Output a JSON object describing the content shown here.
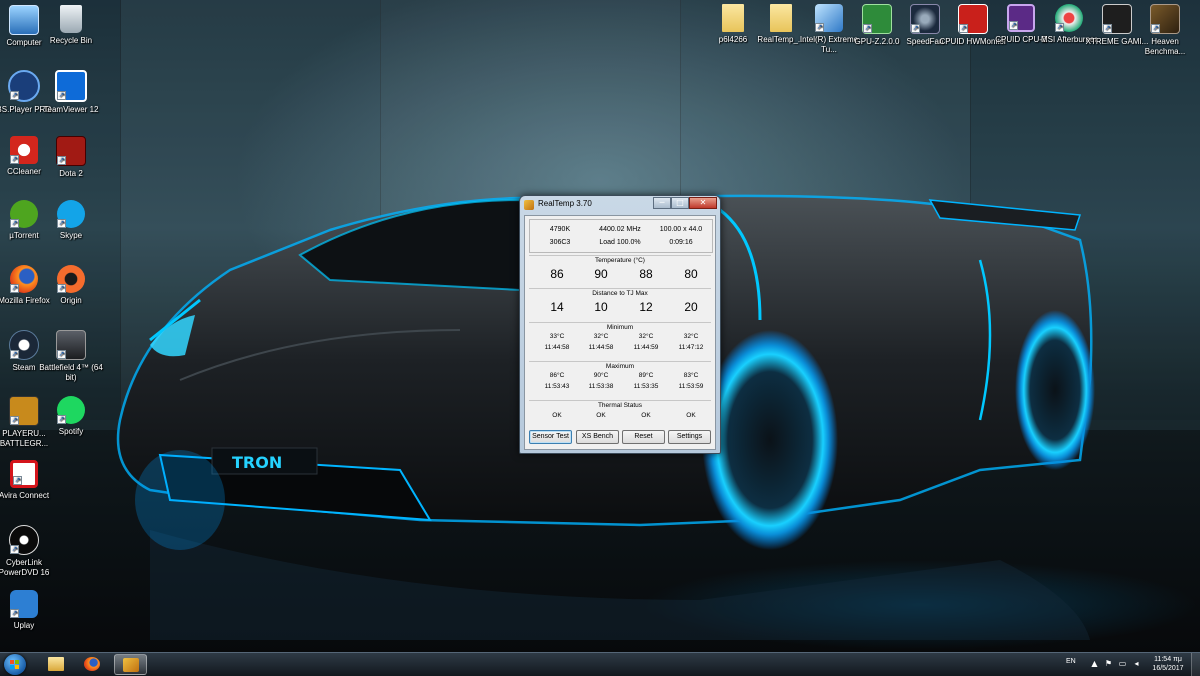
{
  "desktop": {
    "icons_left": [
      {
        "label": "Computer",
        "icon": "computer-icon"
      },
      {
        "label": "Recycle Bin",
        "icon": "recycle-bin-icon"
      },
      {
        "label": "BS.Player PRO",
        "icon": "bsplayer-icon"
      },
      {
        "label": "TeamViewer 12",
        "icon": "teamviewer-icon"
      },
      {
        "label": "CCleaner",
        "icon": "ccleaner-icon"
      },
      {
        "label": "Dota 2",
        "icon": "dota2-icon"
      },
      {
        "label": "µTorrent",
        "icon": "utorrent-icon"
      },
      {
        "label": "Skype",
        "icon": "skype-icon"
      },
      {
        "label": "Mozilla Firefox",
        "icon": "firefox-icon"
      },
      {
        "label": "Origin",
        "icon": "origin-icon"
      },
      {
        "label": "Steam",
        "icon": "steam-icon"
      },
      {
        "label": "Battlefield 4™ (64 bit)",
        "icon": "battlefield4-icon"
      },
      {
        "label": "PLAYERU... BATTLEGR...",
        "icon": "pubg-icon"
      },
      {
        "label": "Spotify",
        "icon": "spotify-icon"
      },
      {
        "label": "Avira Connect",
        "icon": "avira-icon"
      },
      {
        "label": "CyberLink PowerDVD 16",
        "icon": "powerdvd-icon"
      },
      {
        "label": "Uplay",
        "icon": "uplay-icon"
      }
    ],
    "icons_top": [
      {
        "label": "p6l4266",
        "icon": "folder-icon"
      },
      {
        "label": "RealTemp_...",
        "icon": "folder-icon"
      },
      {
        "label": "Intel(R) Extreme Tu...",
        "icon": "intel-xtu-icon"
      },
      {
        "label": "GPU-Z.2.0.0",
        "icon": "gpuz-icon"
      },
      {
        "label": "SpeedFan",
        "icon": "speedfan-icon"
      },
      {
        "label": "CPUID HWMonitor",
        "icon": "hwmonitor-icon"
      },
      {
        "label": "CPUID CPU-Z",
        "icon": "cpuz-icon"
      },
      {
        "label": "MSI Afterburner",
        "icon": "afterburner-icon"
      },
      {
        "label": "XTREME GAMI...",
        "icon": "xtreme-gaming-icon"
      },
      {
        "label": "Heaven Benchma...",
        "icon": "heaven-icon"
      }
    ]
  },
  "realtemp": {
    "title": "RealTemp 3.70",
    "caption": {
      "minimize": "─",
      "maximize": "□",
      "close": "✕"
    },
    "info": {
      "cpu": "4790K",
      "mhz": "4400.02 MHz",
      "multiplier": "100.00 x 44.0",
      "cpuid": "306C3",
      "load": "Load 100.0%",
      "time": "0:09:16"
    },
    "temperature": {
      "title": "Temperature (°C)",
      "values": [
        "86",
        "90",
        "88",
        "80"
      ]
    },
    "distance": {
      "title": "Distance to TJ Max",
      "values": [
        "14",
        "10",
        "12",
        "20"
      ]
    },
    "minimum": {
      "title": "Minimum",
      "temps": [
        "33°C",
        "32°C",
        "32°C",
        "32°C"
      ],
      "times": [
        "11:44:58",
        "11:44:58",
        "11:44:59",
        "11:47:12"
      ]
    },
    "maximum": {
      "title": "Maximum",
      "temps": [
        "86°C",
        "90°C",
        "89°C",
        "83°C"
      ],
      "times": [
        "11:53:43",
        "11:53:38",
        "11:53:35",
        "11:53:59"
      ]
    },
    "thermal": {
      "title": "Thermal Status",
      "values": [
        "OK",
        "OK",
        "OK",
        "OK"
      ]
    },
    "buttons": {
      "sensor_test": "Sensor Test",
      "xs_bench": "XS Bench",
      "reset": "Reset",
      "settings": "Settings"
    }
  },
  "taskbar": {
    "items": [
      {
        "icon": "windows-explorer-icon"
      },
      {
        "icon": "firefox-icon"
      },
      {
        "icon": "realtemp-icon",
        "active": true
      }
    ],
    "tray": {
      "lang": "EN",
      "time": "11:54 πμ",
      "date": "16/5/2017"
    }
  },
  "colors": {
    "accent_glow": "#00b4ff",
    "taskbar": "#1e2830",
    "window_frame": "#b6c9dc"
  }
}
